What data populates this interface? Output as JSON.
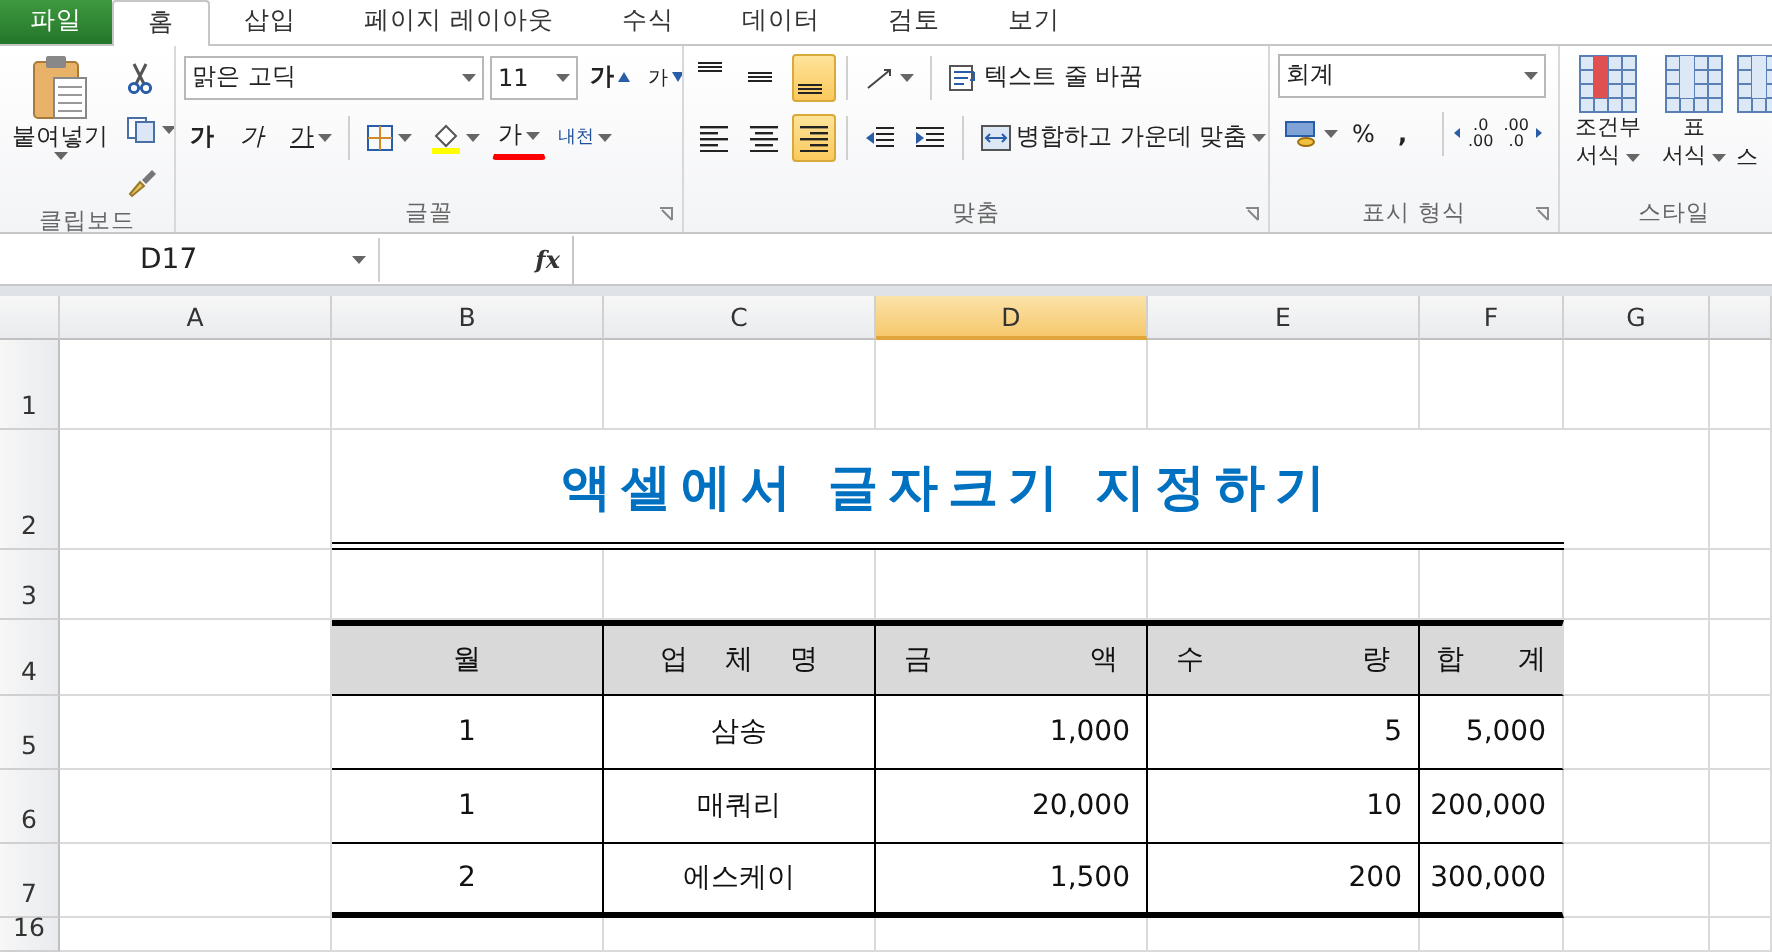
{
  "tabs": [
    {
      "label": "파일",
      "kind": "file",
      "selected": false
    },
    {
      "label": "홈",
      "kind": "tab",
      "selected": true
    },
    {
      "label": "삽입",
      "kind": "tab",
      "selected": false
    },
    {
      "label": "페이지 레이아웃",
      "kind": "tab",
      "selected": false
    },
    {
      "label": "수식",
      "kind": "tab",
      "selected": false
    },
    {
      "label": "데이터",
      "kind": "tab",
      "selected": false
    },
    {
      "label": "검토",
      "kind": "tab",
      "selected": false
    },
    {
      "label": "보기",
      "kind": "tab",
      "selected": false
    }
  ],
  "ribbon": {
    "clipboard": {
      "label": "클립보드",
      "paste": "붙여넣기"
    },
    "font": {
      "label": "글꼴",
      "font_name": "맑은 고딕",
      "font_size": "11",
      "grow": "가",
      "shrink": "가",
      "bold": "가",
      "italic": "가",
      "underline": "가",
      "font_color": "가",
      "phonetic": "내천"
    },
    "alignment": {
      "label": "맞춤",
      "vertical": [
        {
          "kind": "top",
          "selected": false
        },
        {
          "kind": "middle",
          "selected": false
        },
        {
          "kind": "bottom",
          "selected": true
        }
      ],
      "horizontal": [
        {
          "kind": "left",
          "selected": false
        },
        {
          "kind": "center",
          "selected": false
        },
        {
          "kind": "right",
          "selected": true
        }
      ],
      "wrap_text": "텍스트 줄 바꿈",
      "merge": "병합하고 가운데 맞춤"
    },
    "number": {
      "label": "표시 형식",
      "format": "회계",
      "percent": "%",
      "comma": ",",
      "increase_decimal": [
        ".0",
        ".00"
      ],
      "decrease_decimal": [
        ".00",
        ".0"
      ]
    },
    "styles": {
      "label": "스타일",
      "buttons": [
        {
          "kind": "conditional",
          "lines": [
            "조건부",
            "서식"
          ]
        },
        {
          "kind": "table",
          "lines": [
            "표",
            "서식"
          ]
        },
        {
          "kind": "partial",
          "lines": [
            "스"
          ]
        }
      ]
    }
  },
  "formula_bar": {
    "name_box": "D17",
    "fx": "fx"
  },
  "sheet": {
    "columns": [
      {
        "label": "A",
        "selected": false
      },
      {
        "label": "B",
        "selected": false
      },
      {
        "label": "C",
        "selected": false
      },
      {
        "label": "D",
        "selected": true
      },
      {
        "label": "E",
        "selected": false
      },
      {
        "label": "F",
        "selected": false
      },
      {
        "label": "G",
        "selected": false
      }
    ],
    "rows": [
      "1",
      "2",
      "3",
      "4",
      "5",
      "6",
      "7",
      "16"
    ],
    "title": "액셀에서 글자크기 지정하기",
    "table": {
      "columns": [
        {
          "label": "월",
          "kind": "center"
        },
        {
          "label": "업 체 명",
          "kind": "spread"
        },
        {
          "label": "금 액",
          "kind": "spread"
        },
        {
          "label": "수 량",
          "kind": "spread"
        },
        {
          "label": "합 계",
          "kind": "spread"
        }
      ],
      "rows": [
        [
          "1",
          "삼송",
          "1,000",
          "5",
          "5,000"
        ],
        [
          "1",
          "매쿼리",
          "20,000",
          "10",
          "200,000"
        ],
        [
          "2",
          "에스케이",
          "1,500",
          "200",
          "300,000"
        ]
      ]
    }
  }
}
